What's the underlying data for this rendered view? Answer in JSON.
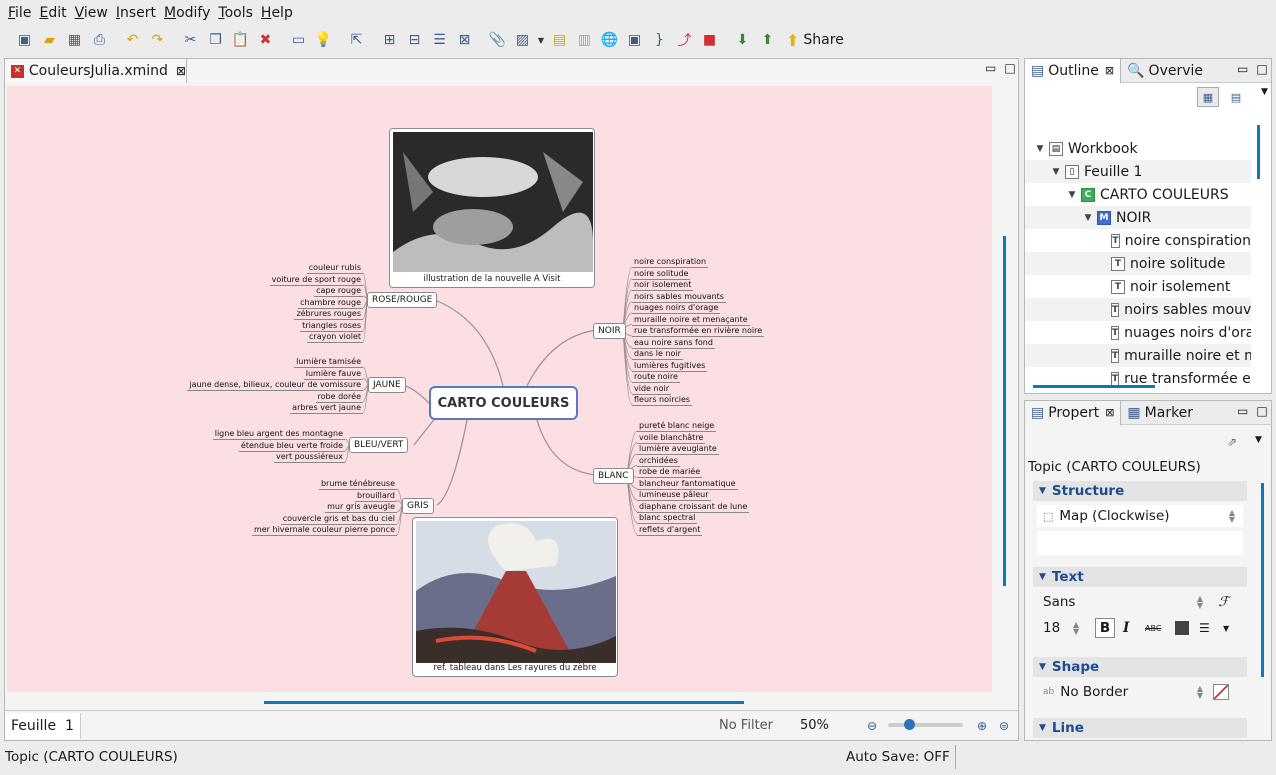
{
  "menu": [
    {
      "label": "File",
      "mnemonic": "F",
      "rest": "ile"
    },
    {
      "label": "Edit",
      "mnemonic": "E",
      "rest": "dit"
    },
    {
      "label": "View",
      "mnemonic": "V",
      "rest": "iew"
    },
    {
      "label": "Insert",
      "mnemonic": "I",
      "rest": "nsert"
    },
    {
      "label": "Modify",
      "mnemonic": "M",
      "rest": "odify"
    },
    {
      "label": "Tools",
      "mnemonic": "T",
      "rest": "ools"
    },
    {
      "label": "Help",
      "mnemonic": "H",
      "rest": "elp"
    }
  ],
  "toolbar": {
    "share_label": "Share"
  },
  "editor": {
    "tab_title": "CouleursJulia.xmind"
  },
  "mindmap": {
    "central": "CARTO COULEURS",
    "top_image_caption": "illustration de la nouvelle A Visit",
    "bottom_image_caption": "ref. tableau dans Les rayures du zèbre",
    "branches": {
      "rose": {
        "label": "ROSE/ROUGE",
        "items": [
          "couleur rubis",
          "voiture de sport rouge",
          "cape rouge",
          "chambre rouge",
          "zébrures rouges",
          "triangles roses",
          "crayon violet"
        ]
      },
      "jaune": {
        "label": "JAUNE",
        "items": [
          "lumière tamisée",
          "lumière fauve",
          "jaune dense, bilieux, couleur de vomissure",
          "robe dorée",
          "arbres vert jaune"
        ]
      },
      "bleu": {
        "label": "BLEU/VERT",
        "items": [
          "ligne bleu argent des montagne",
          "étendue bleu verte froide",
          "vert poussiéreux"
        ]
      },
      "gris": {
        "label": "GRIS",
        "items": [
          "brume ténébreuse",
          "brouillard",
          "mur gris aveugle",
          "couvercle gris et bas du ciel",
          "mer hivernale couleur pierre ponce"
        ]
      },
      "noir": {
        "label": "NOIR",
        "items": [
          "noire conspiration",
          "noire solitude",
          "noir isolement",
          "noirs sables mouvants",
          "nuages noirs d'orage",
          "muraille noire et menaçante",
          "rue transformée en rivière noire",
          "eau noire sans fond",
          "dans le noir",
          "lumières fugitives",
          "route noire",
          "vide noir",
          "fleurs noircies"
        ]
      },
      "blanc": {
        "label": "BLANC",
        "items": [
          "pureté blanc neige",
          "voile blanchâtre",
          "lumière aveuglante",
          "orchidées",
          "robe de mariée",
          "blancheur fantomatique",
          "lumineuse pâleur",
          "diaphane croissant de lune",
          "blanc spectral",
          "reflets d'argent"
        ]
      }
    }
  },
  "sheetbar": {
    "sheet_label": "Feuille",
    "sheet_num": "1",
    "filter": "No Filter",
    "zoom": "50%",
    "zoom_level": 0.25
  },
  "outline": {
    "tab1": "Outline",
    "tab2": "Overvie",
    "tree": [
      {
        "label": "Workbook",
        "icon": "workbook-icon"
      },
      {
        "label": "Feuille  1",
        "icon": "sheet-icon"
      },
      {
        "label": "CARTO COULEURS",
        "icon": "central-topic-icon"
      },
      {
        "label": "NOIR",
        "icon": "main-topic-icon"
      },
      {
        "label": "noire conspiration",
        "icon": "topic-icon"
      },
      {
        "label": "noire solitude",
        "icon": "topic-icon"
      },
      {
        "label": "noir isolement",
        "icon": "topic-icon"
      },
      {
        "label": "noirs sables mouva",
        "icon": "topic-icon"
      },
      {
        "label": "nuages noirs d'orag",
        "icon": "topic-icon"
      },
      {
        "label": "muraille noire et m",
        "icon": "topic-icon"
      },
      {
        "label": "rue transformée en",
        "icon": "topic-icon"
      }
    ]
  },
  "props": {
    "tab1": "Propert",
    "tab2": "Marker",
    "topic_title": "Topic (CARTO COULEURS)",
    "structure": {
      "title": "Structure",
      "value": "Map (Clockwise)"
    },
    "text": {
      "title": "Text",
      "font": "Sans",
      "size": "18",
      "bold": "B",
      "italic": "I",
      "strike": "ABC"
    },
    "shape": {
      "title": "Shape",
      "value": "No Border"
    },
    "line": {
      "title": "Line"
    }
  },
  "status": {
    "left": "Topic (CARTO COULEURS)",
    "autosave": "Auto Save: OFF"
  },
  "colors": {
    "canvas_bg": "#fbdfe2",
    "central_border": "#5b79c2",
    "accent": "#0a7ab8"
  }
}
